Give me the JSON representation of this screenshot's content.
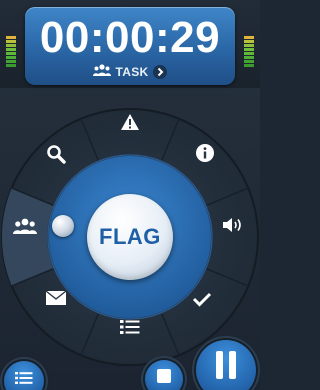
{
  "timer": {
    "elapsed": "00:00:29",
    "mode_label": "TASK"
  },
  "flag_button": {
    "label": "FLAG"
  },
  "segments": [
    {
      "name": "warning",
      "icon": "warning-icon"
    },
    {
      "name": "info",
      "icon": "info-icon"
    },
    {
      "name": "audio",
      "icon": "speaker-icon"
    },
    {
      "name": "check",
      "icon": "check-icon"
    },
    {
      "name": "list",
      "icon": "list-icon"
    },
    {
      "name": "mail",
      "icon": "mail-icon"
    },
    {
      "name": "participants",
      "icon": "users-icon"
    },
    {
      "name": "search",
      "icon": "search-icon"
    }
  ],
  "bottom_controls": {
    "menu": "menu-icon",
    "stop": "stop-icon",
    "pause": "pause-icon"
  },
  "colors": {
    "accent": "#2a6db5",
    "panel": "#3f86c8",
    "background": "#1f2935",
    "meter_green": "#6fbf3a",
    "meter_yellow": "#e0b43a"
  }
}
